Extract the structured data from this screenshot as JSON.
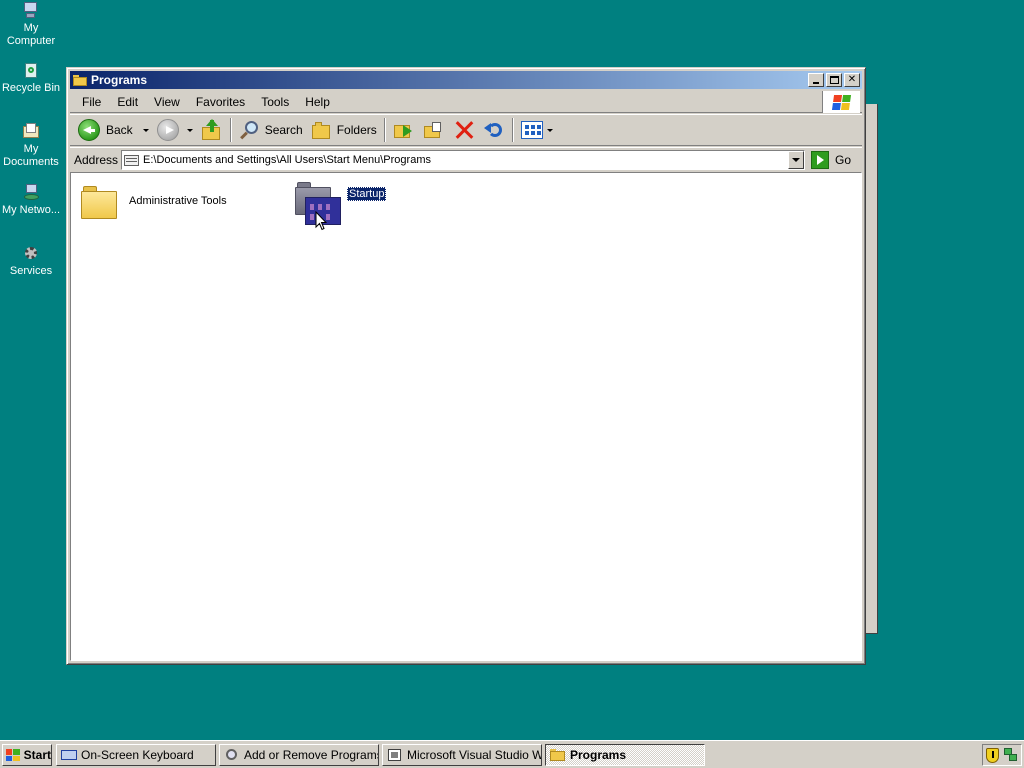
{
  "desktop": {
    "icons": [
      {
        "label": "My Computer",
        "icon": "my-computer-icon"
      },
      {
        "label": "Recycle Bin",
        "icon": "recycle-bin-icon"
      },
      {
        "label": "My Documents",
        "icon": "my-documents-icon"
      },
      {
        "label": "My Netwo...",
        "icon": "network-icon"
      },
      {
        "label": "Services",
        "icon": "services-icon"
      }
    ]
  },
  "window": {
    "title": "Programs",
    "menu": [
      "File",
      "Edit",
      "View",
      "Favorites",
      "Tools",
      "Help"
    ],
    "toolbar": {
      "back": "Back",
      "search": "Search",
      "folders": "Folders"
    },
    "address": {
      "label": "Address",
      "value": "E:\\Documents and Settings\\All Users\\Start Menu\\Programs",
      "go": "Go"
    },
    "items": [
      {
        "name": "Administrative Tools",
        "selected": false
      },
      {
        "name": "Startup",
        "selected": true
      }
    ]
  },
  "taskbar": {
    "start": "Start",
    "tasks": [
      {
        "label": "On-Screen Keyboard",
        "active": false
      },
      {
        "label": "Add or Remove Programs",
        "active": false
      },
      {
        "label": "Microsoft Visual Studio W...",
        "active": false
      },
      {
        "label": "Programs",
        "active": true
      }
    ]
  },
  "colors": {
    "desktop": "#008080",
    "title_active": "#0a246a",
    "face": "#d4d0c8"
  }
}
